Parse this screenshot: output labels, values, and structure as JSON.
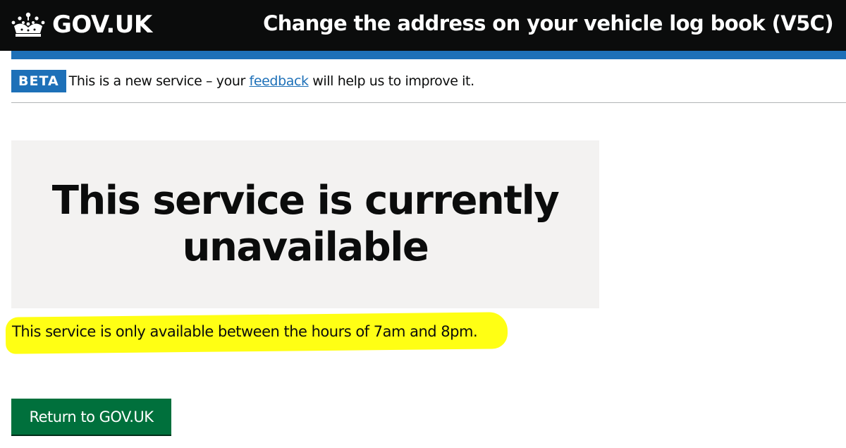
{
  "header": {
    "logo_icon": "crown-icon",
    "logo_text": "GOV.UK",
    "service_name": "Change the address on your vehicle log book (V5C)",
    "colors": {
      "background": "#0b0c0c",
      "accent_bar": "#1d70b8"
    }
  },
  "phase_banner": {
    "tag": "BETA",
    "text_before": "This is a new service – your ",
    "link_text": "feedback",
    "text_after": " will help us to improve it."
  },
  "panel": {
    "title": "This service is currently unavailable",
    "background": "#f3f2f1"
  },
  "body": {
    "message": "This service is only available between the hours of 7am and 8pm.",
    "highlight_color": "#ffff14"
  },
  "actions": {
    "return_label": "Return to GOV.UK",
    "button_color": "#00703c"
  }
}
